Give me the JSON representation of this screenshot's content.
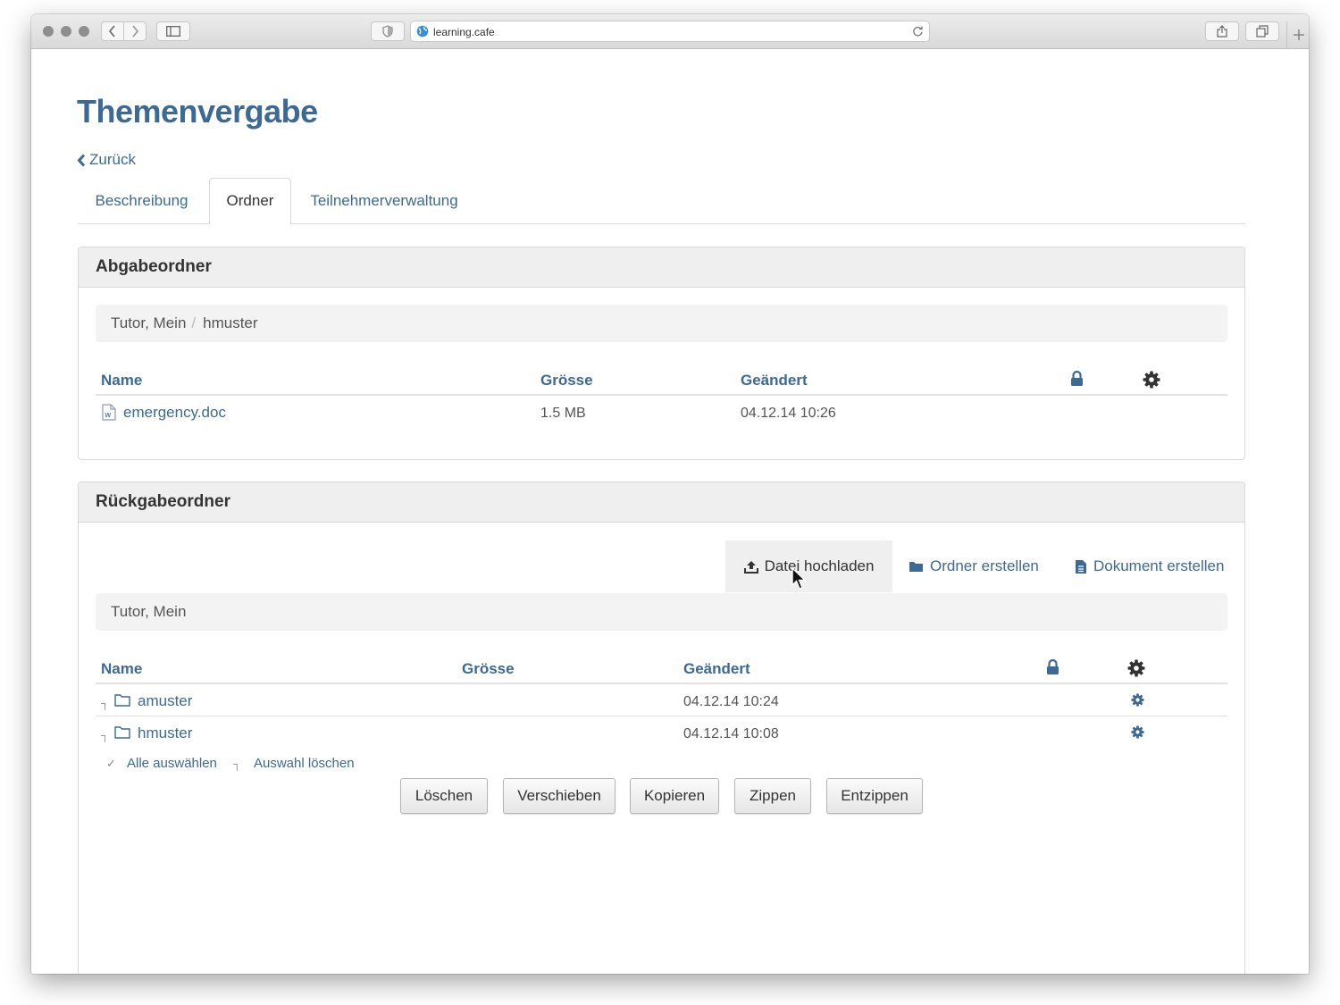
{
  "browser": {
    "url": "learning.cafe"
  },
  "page": {
    "title": "Themenvergabe",
    "back_label": "Zurück"
  },
  "tabs": [
    {
      "label": "Beschreibung",
      "active": false
    },
    {
      "label": "Ordner",
      "active": true
    },
    {
      "label": "Teilnehmerverwaltung",
      "active": false
    }
  ],
  "abgabe": {
    "title": "Abgabeordner",
    "breadcrumb": [
      "Tutor, Mein",
      "hmuster"
    ],
    "columns": {
      "name": "Name",
      "size": "Grösse",
      "modified": "Geändert"
    },
    "files": [
      {
        "name": "emergency.doc",
        "size": "1.5 MB",
        "modified": "04.12.14 10:26"
      }
    ]
  },
  "rueckgabe": {
    "title": "Rückgabeordner",
    "actions": {
      "upload": "Datei hochladen",
      "new_folder": "Ordner erstellen",
      "new_document": "Dokument erstellen"
    },
    "breadcrumb": [
      "Tutor, Mein"
    ],
    "columns": {
      "name": "Name",
      "size": "Grösse",
      "modified": "Geändert"
    },
    "folders": [
      {
        "name": "amuster",
        "modified": "04.12.14 10:24"
      },
      {
        "name": "hmuster",
        "modified": "04.12.14 10:08"
      }
    ],
    "select_all": "Alle auswählen",
    "clear_selection": "Auswahl löschen",
    "buttons": {
      "delete": "Löschen",
      "move": "Verschieben",
      "copy": "Kopieren",
      "zip": "Zippen",
      "unzip": "Entzippen"
    }
  },
  "colors": {
    "accent": "#3c6a94",
    "panel_header": "#efefef"
  },
  "icons": {
    "back": "chevron-left-icon",
    "lock": "lock-icon",
    "settings": "gear-icon",
    "file": "word-document-icon",
    "folder": "folder-outline-icon",
    "upload": "upload-icon",
    "new_folder": "folder-icon",
    "new_document": "document-icon",
    "cursor": "mouse-pointer-icon"
  }
}
